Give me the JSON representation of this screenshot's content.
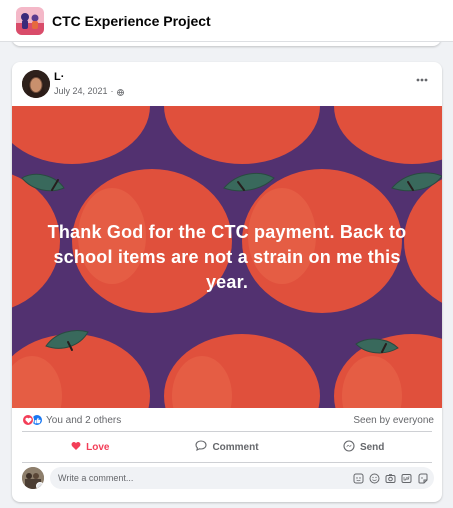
{
  "group": {
    "name": "CTC Experience Project"
  },
  "post": {
    "author": "L·",
    "date": "July 24, 2021",
    "date_separator": "·",
    "privacy_icon": "globe-icon",
    "more_icon": "more-options-icon",
    "text": "Thank God for the CTC payment. Back to school items are not a strain on me this year.",
    "background": {
      "base": "#d9503c",
      "pattern": "apples",
      "dark": "#4a2f73",
      "leaf": "#2f6b5e"
    }
  },
  "reactions": {
    "types": [
      "love-icon",
      "like-icon"
    ],
    "summary": "You and 2 others",
    "seen_by": "Seen by everyone"
  },
  "actions": {
    "love": "Love",
    "comment": "Comment",
    "send": "Send"
  },
  "comment_composer": {
    "placeholder": "Write a comment...",
    "tools": [
      "sticker-icon",
      "emoji-icon",
      "camera-icon",
      "gif-icon",
      "avatar-sticker-icon"
    ]
  },
  "colors": {
    "accent": "#1877f2",
    "love": "#f33e58",
    "muted": "#65676b"
  }
}
